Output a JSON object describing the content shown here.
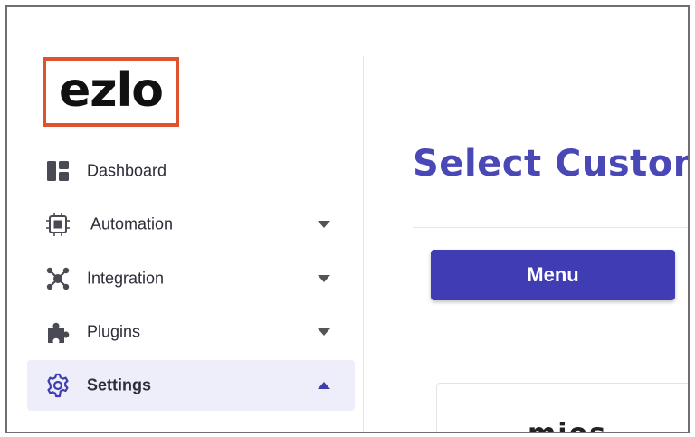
{
  "brand": {
    "logo_text": "ezlo",
    "highlight_color": "#e0522d"
  },
  "sidebar": {
    "items": [
      {
        "label": "Dashboard",
        "icon": "dashboard-icon",
        "expandable": false,
        "expanded": false,
        "active": false
      },
      {
        "label": "Automation",
        "icon": "automation-icon",
        "expandable": true,
        "expanded": false,
        "active": false
      },
      {
        "label": "Integration",
        "icon": "integration-icon",
        "expandable": true,
        "expanded": false,
        "active": false
      },
      {
        "label": "Plugins",
        "icon": "puzzle-icon",
        "expandable": true,
        "expanded": false,
        "active": false
      },
      {
        "label": "Settings",
        "icon": "gear-icon",
        "expandable": true,
        "expanded": true,
        "active": true
      }
    ]
  },
  "main": {
    "title": "Select Custom",
    "menu_button_label": "Menu",
    "card_logo_text": "mios"
  },
  "colors": {
    "accent": "#3f3db1",
    "title": "#4a47b6",
    "active_bg": "#eeeefb"
  }
}
